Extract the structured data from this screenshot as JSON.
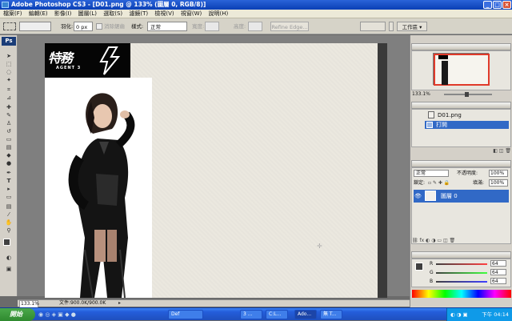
{
  "window": {
    "title": "Adobe Photoshop CS3 - [D01.png @ 133% (圖層 0, RGB/8)]"
  },
  "menu": [
    "檔案(F)",
    "編輯(E)",
    "影像(I)",
    "圖層(L)",
    "選取(S)",
    "濾鏡(T)",
    "檢視(V)",
    "視窗(W)",
    "說明(H)"
  ],
  "options": {
    "feather_label": "羽化:",
    "feather_value": "0 px",
    "antialias_label": "消除鋸齒",
    "style_label": "樣式:",
    "style_value": "正常",
    "width_label": "寬度:",
    "height_label": "高度:",
    "refine_edge": "Refine Edge...",
    "workspace": "工作區 ▾"
  },
  "canvas": {
    "logo_main": "特務",
    "logo_sub": "AGENT 3"
  },
  "status": {
    "zoom": "133.1%",
    "doc_info": "文件:900.0K/900.0K"
  },
  "navigator": {
    "zoom": "133.1%"
  },
  "history": {
    "item1": "D01.png",
    "item2": "打開"
  },
  "layers": {
    "blend_mode": "正常",
    "opacity_label": "不透明度:",
    "opacity_value": "100%",
    "lock_label": "鎖定:",
    "fill_label": "填滿:",
    "fill_value": "100%",
    "layer_name": "圖層 0"
  },
  "color": {
    "r_label": "R",
    "g_label": "G",
    "b_label": "B",
    "r": "64",
    "g": "64",
    "b": "64"
  },
  "taskbar": {
    "start": "開始",
    "items": [
      "Def",
      "3 ...",
      "C:L...",
      "Ado...",
      "無 T..."
    ],
    "clock": "下午 04:14"
  }
}
